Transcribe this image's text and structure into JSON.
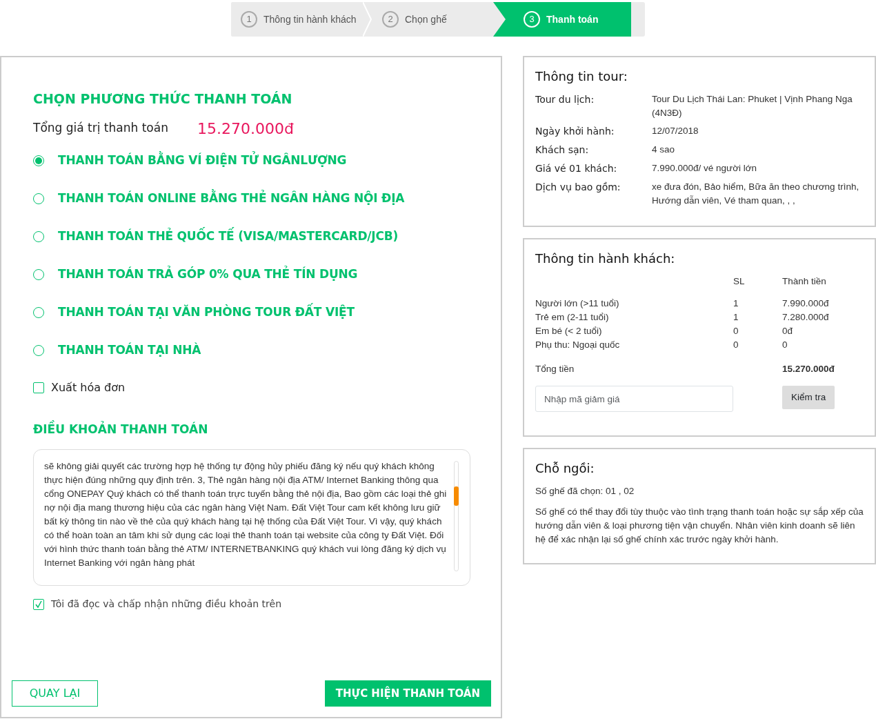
{
  "steps": [
    {
      "number": "1",
      "label": "Thông tin hành khách",
      "selected": false
    },
    {
      "number": "2",
      "label": "Chọn ghế",
      "selected": false
    },
    {
      "number": "3",
      "label": "Thanh toán",
      "selected": true
    }
  ],
  "payment": {
    "title": "CHỌN PHƯƠNG THỨC THANH TOÁN",
    "total_label": "Tổng giá trị thanh toán",
    "total_value": "15.270.000đ",
    "methods": [
      {
        "label": "THANH TOÁN BẰNG VÍ ĐIỆN TỬ NGÂNLƯỢNG",
        "selected": true
      },
      {
        "label": "THANH TOÁN ONLINE BẰNG THẺ NGÂN HÀNG NỘI ĐỊA",
        "selected": false
      },
      {
        "label": "THANH TOÁN THẺ QUỐC TẾ (VISA/MASTERCARD/JCB)",
        "selected": false
      },
      {
        "label": "THANH TOÁN TRẢ GÓP 0% QUA THẺ TÍN DỤNG",
        "selected": false
      },
      {
        "label": "THANH TOÁN TẠI VĂN PHÒNG TOUR ĐẤT VIỆT",
        "selected": false
      },
      {
        "label": "THANH TOÁN TẠI NHÀ",
        "selected": false
      }
    ],
    "invoice": {
      "label": "Xuất hóa đơn",
      "checked": false
    },
    "terms_title": "ĐIỀU KHOẢN THANH TOÁN",
    "terms_text": "sẽ không giải quyết các trường hợp hệ thống tự động hủy phiếu đăng ký nếu quý khách không thực hiện đúng những quy định trên. 3, Thẻ ngân hàng nội địa ATM/ Internet Banking thông qua cổng ONEPAY Quý khách có thể thanh toán trực tuyến bằng thẻ nội địa, Bao gồm các loại thẻ ghi nợ nội địa mang thương hiệu của các ngân hàng Việt Nam. Đất Việt Tour cam kết không lưu giữ bất kỳ thông tin nào về thẻ của quý khách hàng tại hệ thống của Đất Việt Tour. Vì vậy, quý khách có thể hoàn toàn an tâm khi sử dụng các loại thẻ thanh toán tại website của công ty Đất Việt. Đối với hình thức thanh toán bằng thẻ ATM/ INTERNETBANKING quý khách vui lòng đăng ký dịch vụ Internet Banking với ngân hàng phát",
    "agree": {
      "label": "Tôi đã đọc và chấp nhận những điều khoản trên",
      "checked": true
    },
    "back_button": "QUAY LẠI",
    "submit_button": "THỰC HIỆN THANH TOÁN"
  },
  "tour_info": {
    "title": "Thông tin tour:",
    "rows": [
      {
        "label": "Tour du lịch:",
        "value": "Tour Du Lịch Thái Lan: Phuket | Vịnh Phang Nga (4N3Đ)"
      },
      {
        "label": "Ngày khởi hành:",
        "value": "12/07/2018"
      },
      {
        "label": "Khách sạn:",
        "value": "4 sao"
      },
      {
        "label": "Giá vé 01 khách:",
        "value": "7.990.000đ/ vé người lớn"
      },
      {
        "label": "Dịch vụ bao gồm:",
        "value": "xe đưa đón, Bảo hiểm, Bữa ăn theo chương trình, Hướng dẫn viên, Vé tham quan, , ,"
      }
    ]
  },
  "passengers": {
    "title": "Thông tin hành khách:",
    "columns": [
      "SL",
      "Thành tiền"
    ],
    "rows": [
      {
        "type": "Người lớn (>11 tuổi)",
        "qty": "1",
        "amount": "7.990.000đ"
      },
      {
        "type": "Trẻ em (2-11 tuổi)",
        "qty": "1",
        "amount": "7.280.000đ"
      },
      {
        "type": "Em bé (< 2 tuổi)",
        "qty": "0",
        "amount": "0đ"
      },
      {
        "type": "Phụ thu: Ngoại quốc",
        "qty": "0",
        "amount": "0"
      }
    ],
    "total_label": "Tổng tiền",
    "total_value": "15.270.000đ",
    "coupon_placeholder": "Nhập mã giảm giá",
    "check_button": "Kiểm tra"
  },
  "seats": {
    "title": "Chỗ ngồi:",
    "chosen": "Số ghế đã chọn: 01 , 02",
    "note": "Số ghế có thể thay đổi tùy thuộc vào tình trạng thanh toán hoặc sự sắp xếp của hướng dẫn viên & loại phương tiện vận chuyển. Nhân viên kinh doanh sẽ liên hệ để xác nhận lại số ghế chính xác trước ngày khởi hành."
  }
}
